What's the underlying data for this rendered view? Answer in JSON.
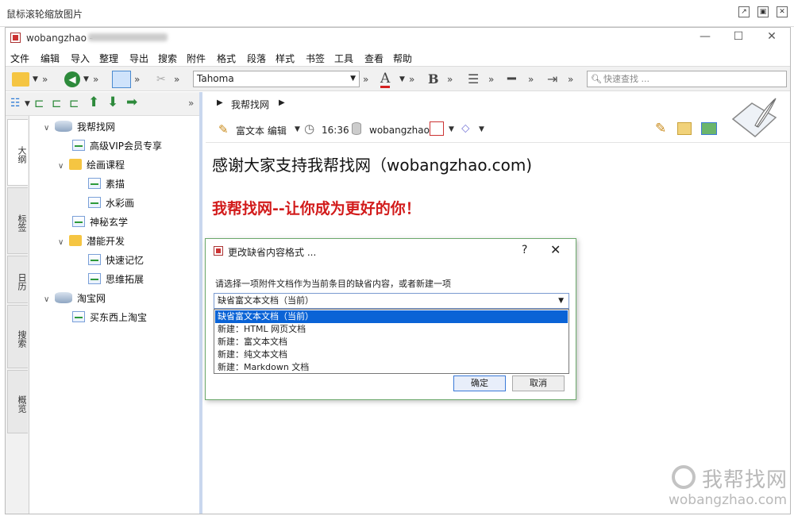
{
  "outer": {
    "title": "鼠标滚轮缩放图片"
  },
  "window": {
    "title": "wobangzhao -",
    "min": "—",
    "max": "☐",
    "close": "✕"
  },
  "menu": [
    "文件",
    "编辑",
    "导入",
    "整理",
    "导出",
    "搜索",
    "附件",
    "格式",
    "段落",
    "样式",
    "书签",
    "工具",
    "查看",
    "帮助"
  ],
  "toolbar": {
    "font": "Tahoma",
    "more": "»",
    "bold": "B",
    "text_color_glyph": "A",
    "search_placeholder": "快速查找 ...",
    "accent_underline": "#d42020"
  },
  "left_toolbar": {
    "more": "»"
  },
  "side_tabs": [
    "大纲",
    "标签",
    "日历",
    "搜索",
    "概览"
  ],
  "tree": [
    {
      "label": "我帮找网",
      "type": "disk",
      "expanded": true,
      "level": 0
    },
    {
      "label": "高级VIP会员专享",
      "type": "page",
      "level": 1
    },
    {
      "label": "绘画课程",
      "type": "folder",
      "expanded": true,
      "level": 1
    },
    {
      "label": "素描",
      "type": "page",
      "level": 2
    },
    {
      "label": "水彩画",
      "type": "page",
      "level": 2
    },
    {
      "label": "神秘玄学",
      "type": "page",
      "level": 1
    },
    {
      "label": "潜能开发",
      "type": "folder",
      "expanded": true,
      "level": 1
    },
    {
      "label": "快速记忆",
      "type": "page",
      "level": 2
    },
    {
      "label": "思维拓展",
      "type": "page",
      "level": 2
    },
    {
      "label": "淘宝网",
      "type": "disk",
      "expanded": true,
      "level": 0
    },
    {
      "label": "买东西上淘宝",
      "type": "page",
      "level": 1
    }
  ],
  "breadcrumb": {
    "item": "我帮找网"
  },
  "infobar": {
    "mode": "富文本 编辑",
    "time": "16:36",
    "user": "wobangzhao"
  },
  "document": {
    "heading": "感谢大家支持我帮找网（wobangzhao.com)",
    "slogan": "我帮找网--让你成为更好的你！",
    "slogan_color": "#d21b1b"
  },
  "dialog": {
    "title": "更改缺省内容格式 ...",
    "help": "?",
    "close": "✕",
    "prompt": "请选择一项附件文档作为当前条目的缺省内容，或者新建一项",
    "selected": "缺省富文本文档（当前）",
    "options": [
      "缺省富文本文档（当前）",
      "新建：HTML 网页文档",
      "新建：富文本文档",
      "新建：纯文本文档",
      "新建：Markdown 文档"
    ],
    "ok": "确定",
    "cancel": "取消"
  },
  "watermark": {
    "name": "我帮找网",
    "url": "wobangzhao.com"
  }
}
